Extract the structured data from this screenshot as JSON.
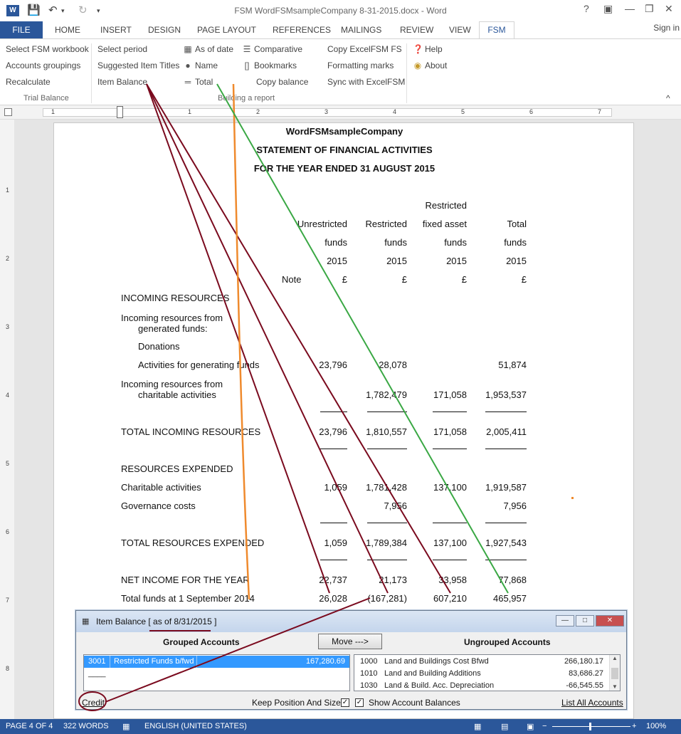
{
  "window": {
    "title": "FSM WordFSMsampleCompany 8-31-2015.docx - Word",
    "app_icon": "W"
  },
  "tabs": [
    "FILE",
    "HOME",
    "INSERT",
    "DESIGN",
    "PAGE LAYOUT",
    "REFERENCES",
    "MAILINGS",
    "REVIEW",
    "VIEW",
    "FSM"
  ],
  "signin": "Sign in",
  "ribbon": {
    "col1": [
      "Select FSM workbook",
      "Accounts groupings",
      "Recalculate"
    ],
    "group1": "Trial Balance",
    "col2": [
      "Select period",
      "Suggested Item Titles",
      "Item Balance"
    ],
    "col3": [
      "As of date",
      "Name",
      "Total"
    ],
    "col4": [
      "Comparative",
      "Bookmarks",
      "Copy balance"
    ],
    "col5": [
      "Copy ExcelFSM FS",
      "Formatting marks",
      "Sync with ExcelFSM"
    ],
    "group2": "Building a report",
    "col6": [
      "Help",
      "About"
    ],
    "collapse": "^"
  },
  "ruler_numbers": [
    "1",
    "1",
    "2",
    "3",
    "4",
    "5",
    "6",
    "7"
  ],
  "vruler_numbers": [
    "1",
    "2",
    "3",
    "4",
    "5",
    "6",
    "7",
    "8"
  ],
  "document": {
    "company": "WordFSMsampleCompany",
    "heading": "STATEMENT OF FINANCIAL ACTIVITIES",
    "period": "FOR THE YEAR ENDED 31 AUGUST 2015",
    "col_head": {
      "restricted_top": "Restricted",
      "h1": [
        "Unrestricted",
        "Restricted",
        "fixed asset",
        "Total"
      ],
      "h2": [
        "funds",
        "funds",
        "funds",
        "funds"
      ],
      "h3": [
        "2015",
        "2015",
        "2015",
        "2015"
      ],
      "note": "Note",
      "cur": [
        "£",
        "£",
        "£",
        "£"
      ]
    },
    "incoming": "INCOMING RESOURCES",
    "inc_gen_1": "Incoming resources from",
    "inc_gen_2": "generated funds:",
    "donations": "Donations",
    "activities": "Activities for generating funds",
    "activities_vals": [
      "23,796",
      "28,078",
      "",
      "51,874"
    ],
    "inc_char_1": "Incoming resources from",
    "inc_char_2": "charitable activities",
    "inc_char_vals": [
      "",
      "1,782,479",
      "171,058",
      "1,953,537"
    ],
    "total_incoming": "TOTAL INCOMING RESOURCES",
    "total_incoming_vals": [
      "23,796",
      "1,810,557",
      "171,058",
      "2,005,411"
    ],
    "expended": "RESOURCES EXPENDED",
    "charitable": "Charitable activities",
    "charitable_vals": [
      "1,059",
      "1,781,428",
      "137,100",
      "1,919,587"
    ],
    "governance": "Governance costs",
    "governance_vals": [
      "",
      "7,956",
      "",
      "7,956"
    ],
    "total_expended": "TOTAL RESOURCES EXPENDED",
    "total_expended_vals": [
      "1,059",
      "1,789,384",
      "137,100",
      "1,927,543"
    ],
    "net_income": "NET INCOME FOR THE YEAR",
    "net_income_vals": [
      "22,737",
      "21,173",
      "33,958",
      "77,868"
    ],
    "total_funds": "Total funds at 1 September 2014",
    "total_funds_vals": [
      "26,028",
      "(167,281)",
      "607,210",
      "465,957"
    ]
  },
  "dialog": {
    "title": "Item Balance [ as of 8/31/2015 ]",
    "grouped": "Grouped Accounts",
    "move": "Move --->",
    "ungrouped": "Ungrouped Accounts",
    "grouped_row": {
      "code": "3001",
      "name": "Restricted Funds b/fwd",
      "value": "167,280.69"
    },
    "grouped_blank": "____",
    "ungrouped_rows": [
      {
        "code": "1000",
        "name": "Land and Buildings Cost Bfwd",
        "value": "266,180.17"
      },
      {
        "code": "1010",
        "name": "Land and Building Additions",
        "value": "83,686.27"
      },
      {
        "code": "1030",
        "name": "Land & Build. Acc. Depreciation",
        "value": "-66,545.55"
      }
    ],
    "credit": "Credit",
    "keep": "Keep Position And Size",
    "show": "Show Account Balances",
    "list_all": "List All Accounts",
    "check": "✓"
  },
  "status": {
    "page": "PAGE 4 OF 4",
    "words": "322 WORDS",
    "language": "ENGLISH (UNITED STATES)",
    "zoom": "100%"
  },
  "colors": {
    "word_blue": "#2b579a",
    "arrow_dark_red": "#7a0a1e",
    "arrow_orange": "#ef8a2d",
    "arrow_green": "#3aa844"
  }
}
